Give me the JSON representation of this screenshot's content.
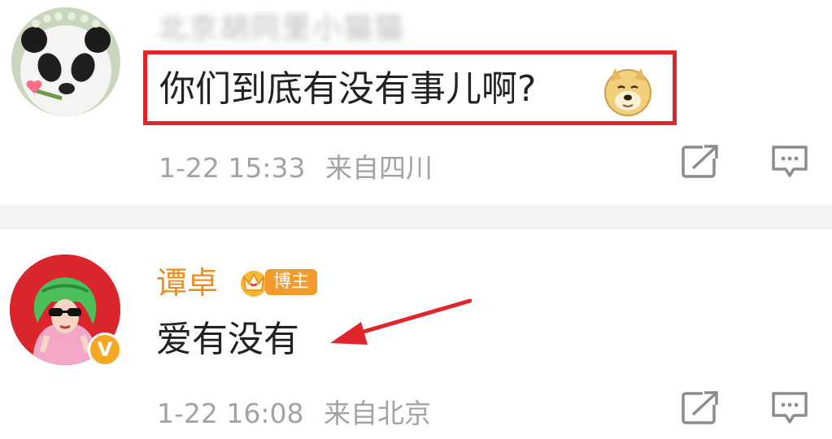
{
  "comments": [
    {
      "username": "北京胡同里小猫猫",
      "text": "你们到底有没有事儿啊?",
      "time": "1-22 15:33",
      "location": "来自四川",
      "avatar": "panda-avatar",
      "emoji": "doge-emoji",
      "highlighted": true
    },
    {
      "username": "谭卓",
      "badge": "博主",
      "text": "爱有没有",
      "time": "1-22 16:08",
      "location": "来自北京",
      "avatar": "woman-green-hair-avatar",
      "verified": "V"
    }
  ],
  "colors": {
    "username_accent": "#f08d1a",
    "badge_bg": "#f39a2c",
    "highlight": "#e0252b",
    "meta_text": "#a3a3a3"
  }
}
